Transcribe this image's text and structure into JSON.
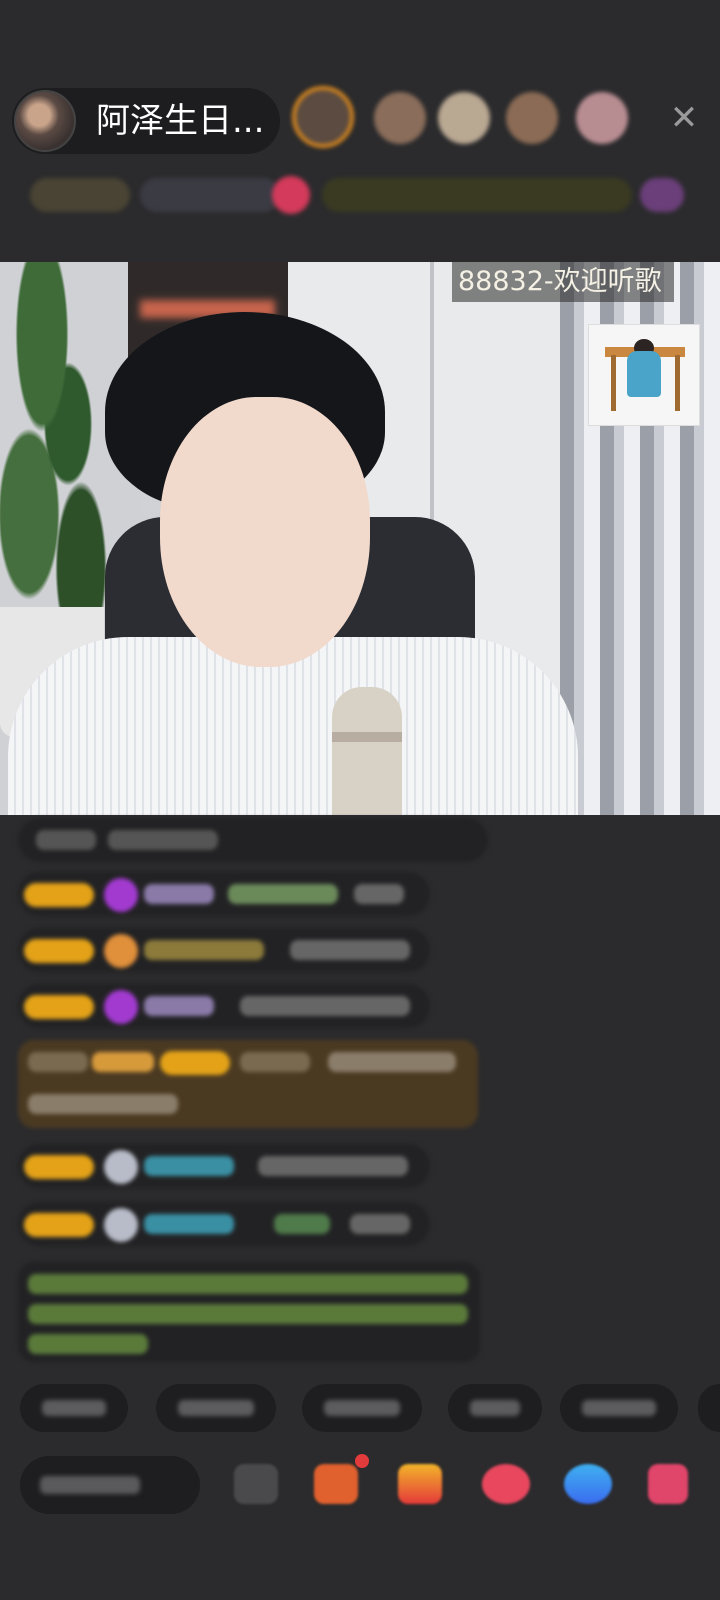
{
  "header": {
    "host_name": "阿泽生日...",
    "close_symbol": "✕"
  },
  "viewers": {
    "avatar_colors": [
      "#d6861f",
      "#8a6d5a",
      "#b9a892",
      "#8b6b55",
      "#b88d92"
    ]
  },
  "stream": {
    "room_banner": "88832-欢迎听歌",
    "accent_color": "#e3a218"
  },
  "icons": {
    "close": "close-icon",
    "emoji": "emoji-icon",
    "gift_box": "gift-box-icon",
    "treasure": "treasure-icon",
    "heart": "heart-icon",
    "game": "game-controller-icon",
    "more": "more-apps-icon"
  }
}
